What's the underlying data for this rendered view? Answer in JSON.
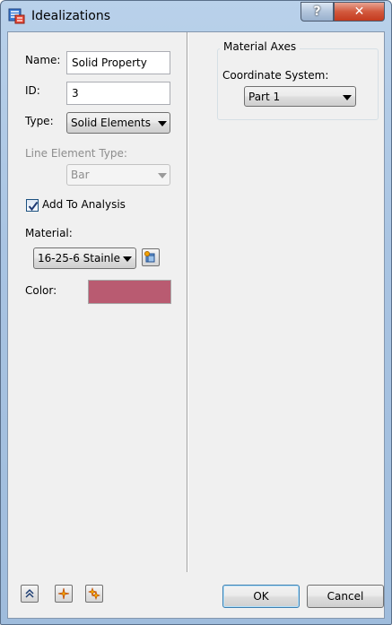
{
  "window": {
    "title": "Idealizations"
  },
  "titlebar": {
    "help_label": "?",
    "close_label": "✕"
  },
  "form": {
    "name": {
      "label": "Name:",
      "value": "Solid Property"
    },
    "id": {
      "label": "ID:",
      "value": "3"
    },
    "type": {
      "label": "Type:",
      "value": "Solid Elements"
    },
    "line_element_type": {
      "label": "Line Element Type:",
      "value": "Bar",
      "enabled": false
    },
    "add_to_analysis": {
      "label": "Add To Analysis",
      "checked": true
    },
    "material": {
      "label": "Material:",
      "value": "16-25-6 Stainle"
    },
    "color": {
      "label": "Color:",
      "value": "#b95b71"
    }
  },
  "material_axes": {
    "title": "Material Axes",
    "coordinate_system": {
      "label": "Coordinate System:",
      "value": "Part 1"
    }
  },
  "footer": {
    "icons": [
      "collapse-icon",
      "star-burst-icon",
      "multi-star-burst-icon"
    ],
    "ok_label": "OK",
    "cancel_label": "Cancel"
  },
  "colors": {
    "titlebar": "#b9d1ea",
    "client_bg": "#f0f0f0",
    "close_button": "#c43a1e",
    "accent_border": "#3c7fb1"
  }
}
